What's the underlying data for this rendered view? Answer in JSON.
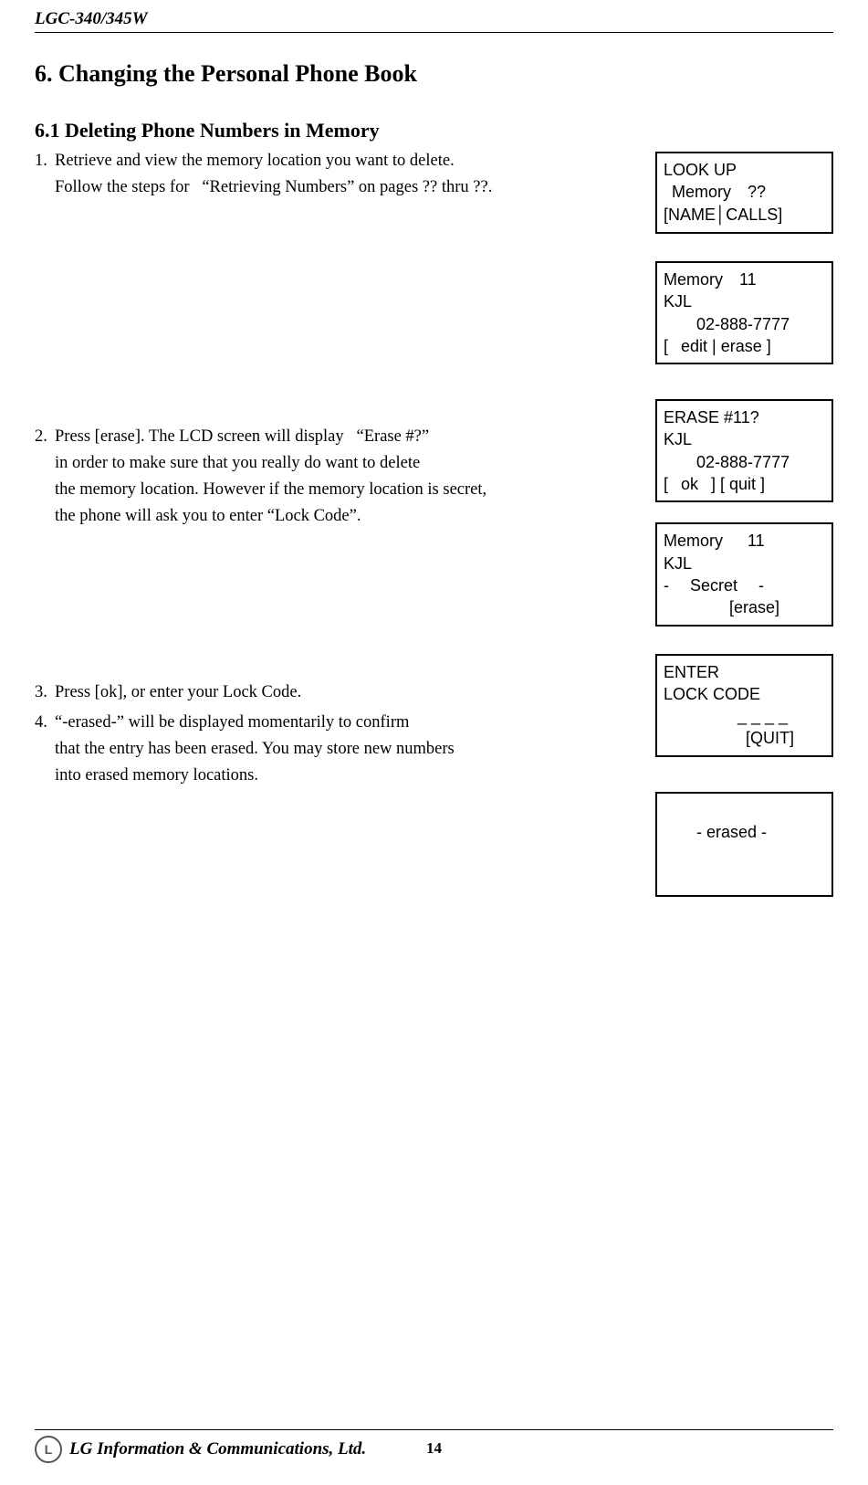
{
  "header_model": "LGC-340/345W",
  "h1": "6. Changing the Personal Phone Book",
  "h2": "6.1 Deleting Phone Numbers in Memory",
  "step1": {
    "num": "1.",
    "l1": "Retrieve and view the memory location you want to delete.",
    "l2": "Follow the steps for  “Retrieving Numbers” on pages ?? thru ??."
  },
  "step2": {
    "num": "2.",
    "l1": "Press [erase]. The LCD screen will display  “Erase #?”",
    "l2": "in order to make sure that you really do want to delete",
    "l3": "the memory location. However if the memory location is secret,",
    "l4": "the phone will ask you to enter “Lock Code”."
  },
  "step3": {
    "num": "3.",
    "l1": "Press [ok], or enter your Lock Code."
  },
  "step4": {
    "num": "4.",
    "l1": "“-erased-” will be displayed momentarily to confirm",
    "l2": "that the entry has been erased. You may store new numbers",
    "l3": "into erased memory locations."
  },
  "screen1": {
    "l1": "LOOK UP",
    "l2": " Memory  ??",
    "l3": "",
    "l4": "[NAME│CALLS]"
  },
  "screen2": {
    "l1": "Memory  11",
    "l2": "KJL",
    "l3": "    02-888-7777",
    "l4": "[  edit | erase ]"
  },
  "screen3": {
    "l1": "ERASE #11?",
    "l2": "KJL",
    "l3": "    02-888-7777",
    "l4": "[  ok  ] [ quit ]"
  },
  "screen4": {
    "l1": "Memory   11",
    "l2": "KJL",
    "l3": "-   Secret   -",
    "l4": "        [erase]"
  },
  "screen5": {
    "l1": "ENTER",
    "l2": "LOCK CODE",
    "l3": "         _ _ _ _",
    "l4": "          [QUIT]"
  },
  "screen6": {
    "l1": "",
    "l2": "    - erased -",
    "l3": "",
    "l4": ""
  },
  "footer_company": "LG Information & Communications, Ltd.",
  "page_number": "14",
  "logo_text": "L"
}
